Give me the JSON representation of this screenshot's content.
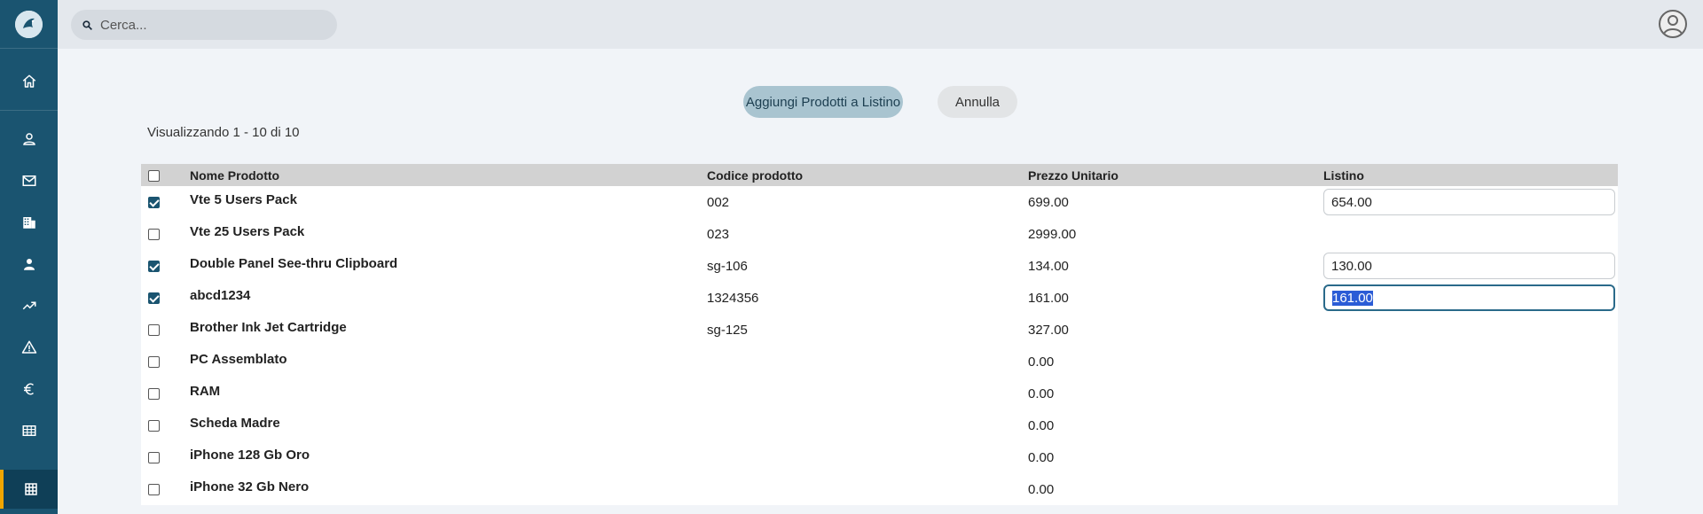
{
  "sidebar": {
    "nav": [
      {
        "name": "home-icon"
      },
      {
        "name": "user-icon"
      },
      {
        "name": "mail-icon"
      },
      {
        "name": "building-icon"
      },
      {
        "name": "contact-icon"
      },
      {
        "name": "trending-icon"
      },
      {
        "name": "warning-icon"
      },
      {
        "name": "euro-icon"
      },
      {
        "name": "table-icon"
      },
      {
        "name": "grid-icon"
      }
    ]
  },
  "topbar": {
    "search_placeholder": "Cerca..."
  },
  "actions": {
    "add_label": "Aggiungi Prodotti a Listino",
    "cancel_label": "Annulla"
  },
  "showing": "Visualizzando 1 - 10 di 10",
  "table": {
    "headers": {
      "name": "Nome Prodotto",
      "code": "Codice prodotto",
      "price": "Prezzo Unitario",
      "list": "Listino"
    },
    "rows": [
      {
        "checked": true,
        "name": "Vte 5 Users Pack",
        "code": "002",
        "price": "699.00",
        "list": "654.00"
      },
      {
        "checked": false,
        "name": "Vte 25 Users Pack",
        "code": "023",
        "price": "2999.00",
        "list": ""
      },
      {
        "checked": true,
        "name": "Double Panel See-thru Clipboard",
        "code": "sg-106",
        "price": "134.00",
        "list": "130.00"
      },
      {
        "checked": true,
        "name": "abcd1234",
        "code": "1324356",
        "price": "161.00",
        "list": "161.00",
        "focused": true
      },
      {
        "checked": false,
        "name": "Brother Ink Jet Cartridge",
        "code": "sg-125",
        "price": "327.00",
        "list": ""
      },
      {
        "checked": false,
        "name": "PC Assemblato",
        "code": "",
        "price": "0.00",
        "list": ""
      },
      {
        "checked": false,
        "name": "RAM",
        "code": "",
        "price": "0.00",
        "list": ""
      },
      {
        "checked": false,
        "name": "Scheda Madre",
        "code": "",
        "price": "0.00",
        "list": ""
      },
      {
        "checked": false,
        "name": "iPhone 128 Gb Oro",
        "code": "",
        "price": "0.00",
        "list": ""
      },
      {
        "checked": false,
        "name": "iPhone 32 Gb Nero",
        "code": "",
        "price": "0.00",
        "list": ""
      }
    ]
  },
  "colors": {
    "sidebar": "#1a5470",
    "accent": "#f0a500",
    "primary_button": "#a9c4d0"
  }
}
